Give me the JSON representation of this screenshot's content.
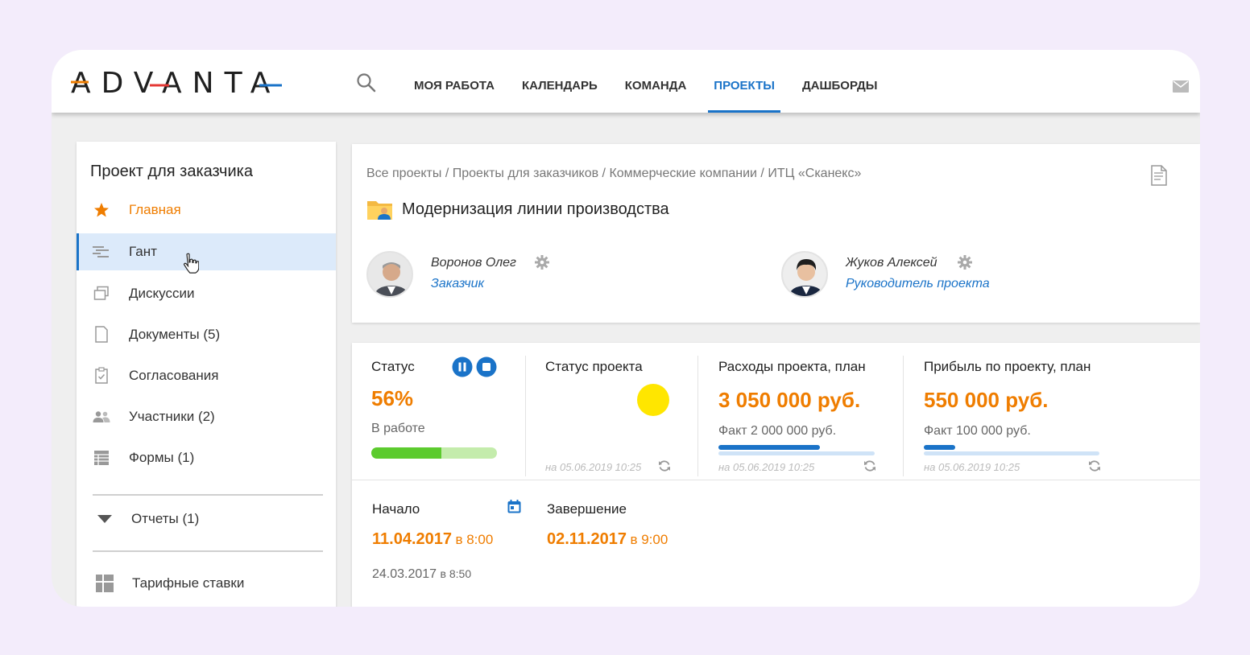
{
  "header": {
    "logo_text": "ADVANTA",
    "nav": [
      {
        "label": "МОЯ РАБОТА",
        "active": false
      },
      {
        "label": "КАЛЕНДАРЬ",
        "active": false
      },
      {
        "label": "КОМАНДА",
        "active": false
      },
      {
        "label": "ПРОЕКТЫ",
        "active": true
      },
      {
        "label": "ДАШБОРДЫ",
        "active": false
      }
    ],
    "icons": [
      "search-icon",
      "mail-icon"
    ],
    "accent_color": "#1a73c8"
  },
  "sidebar": {
    "title": "Проект для заказчика",
    "items": [
      {
        "label": "Главная",
        "icon": "star-icon"
      },
      {
        "label": "Гант",
        "icon": "gantt-icon",
        "active": true
      },
      {
        "label": "Дискуссии",
        "icon": "discussions-icon"
      },
      {
        "label": "Документы (5)",
        "icon": "document-icon"
      },
      {
        "label": "Согласования",
        "icon": "approval-icon"
      },
      {
        "label": "Участники (2)",
        "icon": "people-icon"
      },
      {
        "label": "Формы (1)",
        "icon": "forms-icon"
      }
    ],
    "reports": {
      "label": "Отчеты (1)",
      "icon": "caret-down-icon"
    },
    "rates": {
      "label": "Тарифные ставки",
      "icon": "table-icon"
    }
  },
  "project": {
    "breadcrumb": "Все проекты / Проекты для заказчиков / Коммерческие компании / ИТЦ «Сканекс»",
    "title": "Модернизация линии производства",
    "people": [
      {
        "name": "Воронов Олег",
        "role": "Заказчик"
      },
      {
        "name": "Жуков Алексей",
        "role": "Руководитель проекта"
      }
    ]
  },
  "kpis": {
    "status": {
      "title": "Статус",
      "percent": "56%",
      "state": "В работе",
      "progress": 0.56
    },
    "project_status": {
      "title": "Статус проекта",
      "indicator_color": "#ffe600",
      "date": "на 05.06.2019 10:25"
    },
    "costs": {
      "title": "Расходы проекта, план",
      "value": "3 050 000 руб.",
      "fact": "Факт  2 000 000 руб.",
      "fact_ratio": 0.65,
      "date": "на 05.06.2019 10:25"
    },
    "profit": {
      "title": "Прибыль по проекту, план",
      "value": "550 000 руб.",
      "fact": "Факт  100 000 руб.",
      "fact_ratio": 0.18,
      "date": "на 05.06.2019 10:25"
    }
  },
  "dates": {
    "start": {
      "title": "Начало",
      "date": "11.04.2017",
      "time": "в 8:00",
      "baseline_date": "24.03.2017",
      "baseline_time": "в 8:50"
    },
    "end": {
      "title": "Завершение",
      "date": "02.11.2017",
      "time": "в 9:00"
    }
  },
  "colors": {
    "orange": "#ef7d00",
    "blue": "#1a73c8",
    "green": "#5ccb2e"
  }
}
